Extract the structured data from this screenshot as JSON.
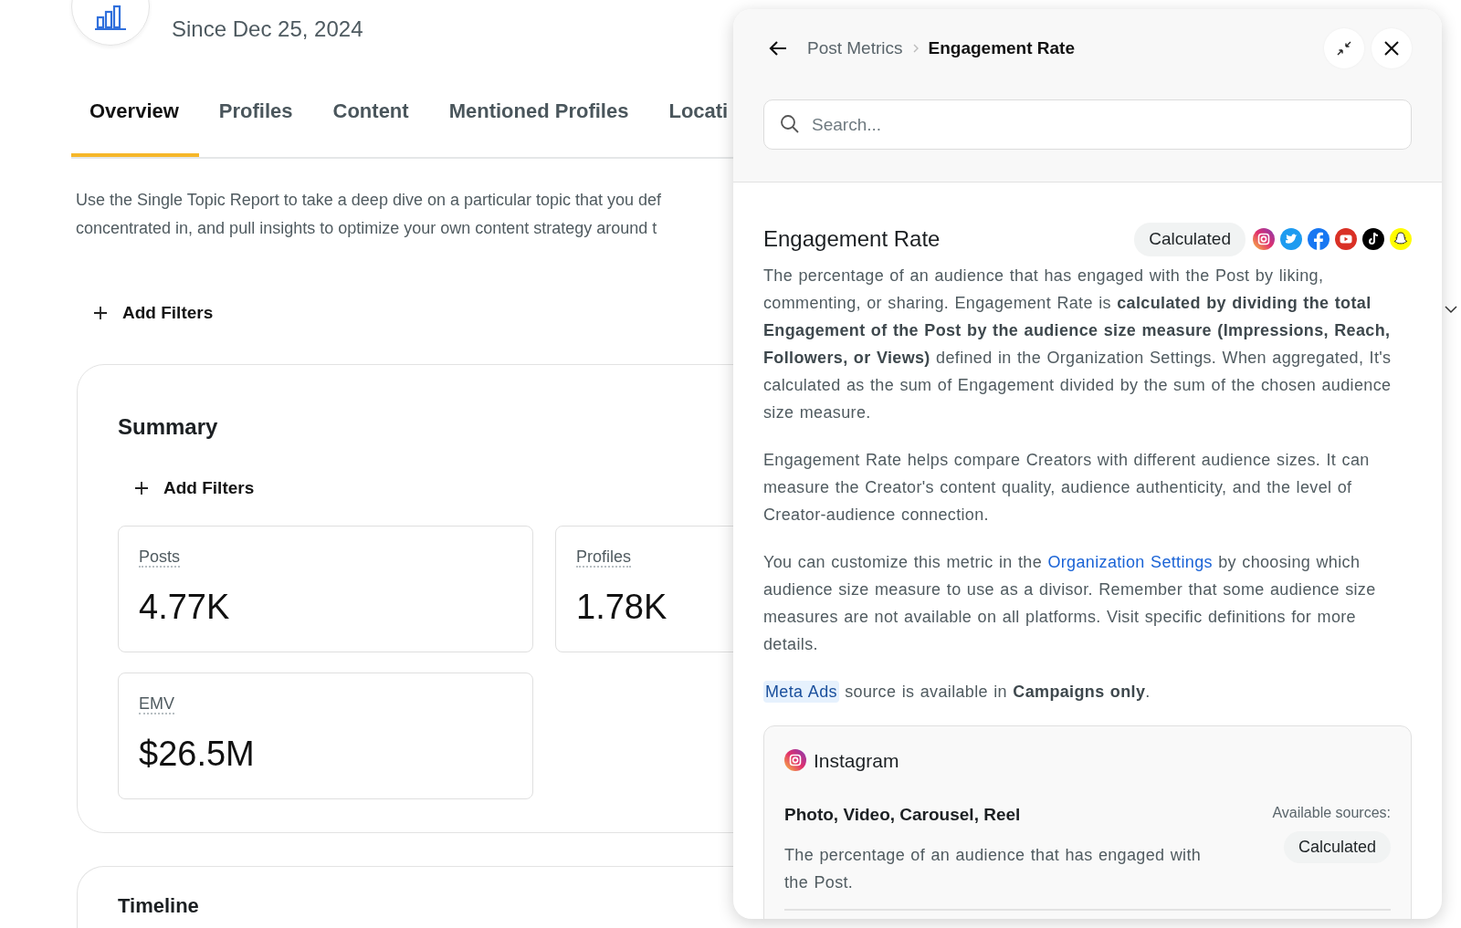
{
  "report": {
    "subtitle": "Since Dec 25, 2024"
  },
  "tabs": [
    {
      "label": "Overview",
      "selected": true
    },
    {
      "label": "Profiles",
      "selected": false
    },
    {
      "label": "Content",
      "selected": false
    },
    {
      "label": "Mentioned Profiles",
      "selected": false
    },
    {
      "label": "Locati",
      "selected": false
    }
  ],
  "description_lines": [
    "Use the Single Topic Report to take a deep dive on a particular topic that you def",
    "concentrated in, and pull insights to optimize your own content strategy around t"
  ],
  "add_filters": "Add Filters",
  "summary": {
    "title": "Summary",
    "add_filters": "Add Filters",
    "metrics": [
      {
        "label": "Posts",
        "value": "4.77K"
      },
      {
        "label": "Profiles",
        "value": "1.78K"
      },
      {
        "label": "EMV",
        "value": "$26.5M"
      }
    ]
  },
  "timeline": {
    "title": "Timeline"
  },
  "panel": {
    "breadcrumb": [
      "Post Metrics",
      "Engagement Rate"
    ],
    "search": {
      "placeholder": "Search..."
    },
    "title": "Engagement Rate",
    "badge": "Calculated",
    "paragraphs": [
      [
        {
          "kind": "text",
          "text": "The percentage of an audience that has engaged with the Post by liking, commenting, or sharing. Engagement Rate is **calculated by dividing the total Engagement of the Post by the audience size measure (Impressions, Reach, Followers, or Views)** defined in the Organization Settings. When aggregated, It's calculated as the sum of Engagement divided by the sum of the chosen audience size measure."
        }
      ],
      [
        {
          "kind": "text",
          "text": "Engagement Rate helps compare Creators with different audience sizes. It can measure the Creator's content quality, audience authenticity, and the level of Creator-audience connection."
        }
      ],
      [
        {
          "kind": "text",
          "text": "You can customize this metric in the "
        },
        {
          "kind": "link",
          "text": "Organization Settings"
        },
        {
          "kind": "text",
          "text": " by choosing which audience size measure to use as a divisor. Remember that some audience size measures are not available on all platforms. Visit specific definitions for more details."
        }
      ],
      [
        {
          "kind": "chip",
          "text": "Meta Ads"
        },
        {
          "kind": "text",
          "text": " source is available in **Campaigns only**."
        }
      ]
    ],
    "platform": {
      "name": "Instagram",
      "types": "Photo, Video, Carousel, Reel",
      "sources_label": "Available sources:",
      "sources": [
        "Calculated"
      ],
      "description": "The percentage of an audience that has engaged with the Post."
    }
  }
}
